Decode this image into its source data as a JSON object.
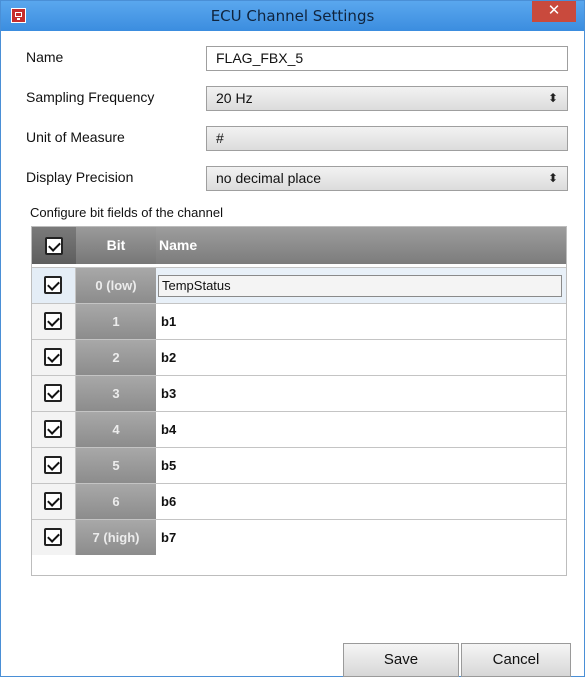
{
  "window": {
    "title": "ECU Channel Settings",
    "close_glyph": "✕",
    "app_icon": "app-window-icon"
  },
  "form": {
    "name_label": "Name",
    "name_value": "FLAG_FBX_5",
    "sampling_label": "Sampling Frequency",
    "sampling_value": "20 Hz",
    "unit_label": "Unit of Measure",
    "unit_value": "#",
    "precision_label": "Display Precision",
    "precision_value": "no decimal place",
    "select_arrows": "⬍"
  },
  "bitfields": {
    "caption": "Configure bit fields of the channel",
    "header": {
      "bit": "Bit",
      "name": "Name"
    },
    "rows": [
      {
        "bit": "0 (low)",
        "name": "TempStatus",
        "checked": true,
        "editing": true
      },
      {
        "bit": "1",
        "name": "b1",
        "checked": true
      },
      {
        "bit": "2",
        "name": "b2",
        "checked": true
      },
      {
        "bit": "3",
        "name": "b3",
        "checked": true
      },
      {
        "bit": "4",
        "name": "b4",
        "checked": true
      },
      {
        "bit": "5",
        "name": "b5",
        "checked": true
      },
      {
        "bit": "6",
        "name": "b6",
        "checked": true
      },
      {
        "bit": "7 (high)",
        "name": "b7",
        "checked": true
      }
    ]
  },
  "buttons": {
    "save": "Save",
    "cancel": "Cancel"
  },
  "colors": {
    "titlebar": "#3b8ddf",
    "close": "#c94a3d",
    "header": "#8a8a8a"
  }
}
